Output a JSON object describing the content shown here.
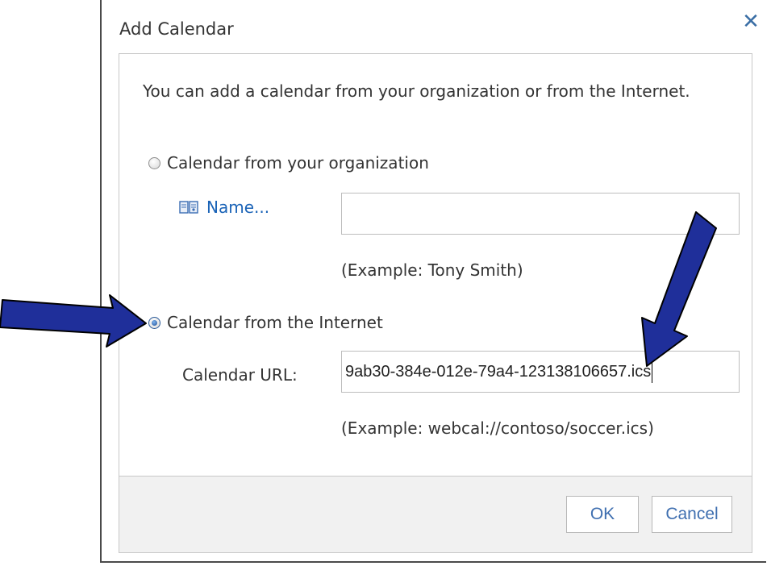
{
  "dialog": {
    "title": "Add Calendar",
    "close_glyph": "✕",
    "intro": "You can add a calendar from your organization or from the Internet."
  },
  "organization": {
    "radio_label": "Calendar from your organization",
    "selected": false,
    "name_link": "Name...",
    "name_icon": "address-book-icon",
    "name_value": "",
    "example": "(Example: Tony Smith)"
  },
  "internet": {
    "radio_label": "Calendar from the Internet",
    "selected": true,
    "url_label": "Calendar URL:",
    "url_value": "9ab30-384e-012e-79a4-123138106657.ics",
    "example": "(Example: webcal://contoso/soccer.ics)"
  },
  "buttons": {
    "ok": "OK",
    "cancel": "Cancel"
  },
  "colors": {
    "link": "#1a63b7",
    "button_text": "#3f6fb0",
    "annotation_arrow": "#1f2f9a"
  }
}
